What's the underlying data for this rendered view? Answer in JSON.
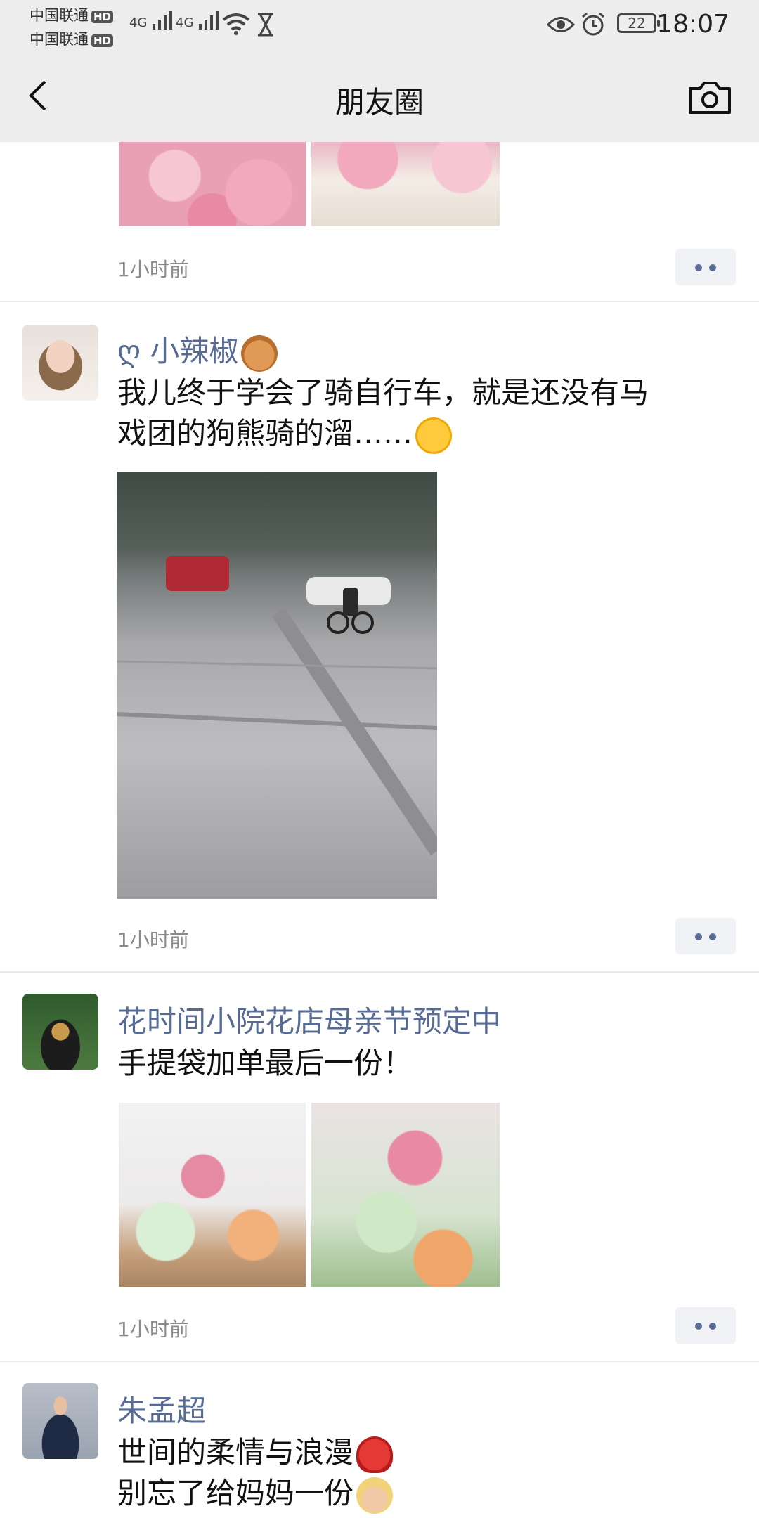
{
  "status_bar": {
    "carrier1": "中国联通",
    "carrier2": "中国联通",
    "hd_badge": "HD",
    "net1": "4G",
    "net2": "4G",
    "battery": "22",
    "time": "18:07"
  },
  "nav": {
    "title": "朋友圈"
  },
  "posts": [
    {
      "time": "1小时前"
    },
    {
      "nickname": "ღ 小辣椒",
      "text_line1": "我儿终于学会了骑自行车，就是还没有马",
      "text_line2": "戏团的狗熊骑的溜……",
      "time": "1小时前"
    },
    {
      "nickname": "花时间小院花店母亲节预定中",
      "text_line1": "手提袋加单最后一份！",
      "time": "1小时前"
    },
    {
      "nickname": "朱孟超",
      "text_line1": "世间的柔情与浪漫",
      "text_line2": "别忘了给妈妈一份"
    }
  ],
  "colors": {
    "link": "#576b95",
    "bar_bg": "#ededed",
    "meta_text": "#8a8a8a"
  }
}
